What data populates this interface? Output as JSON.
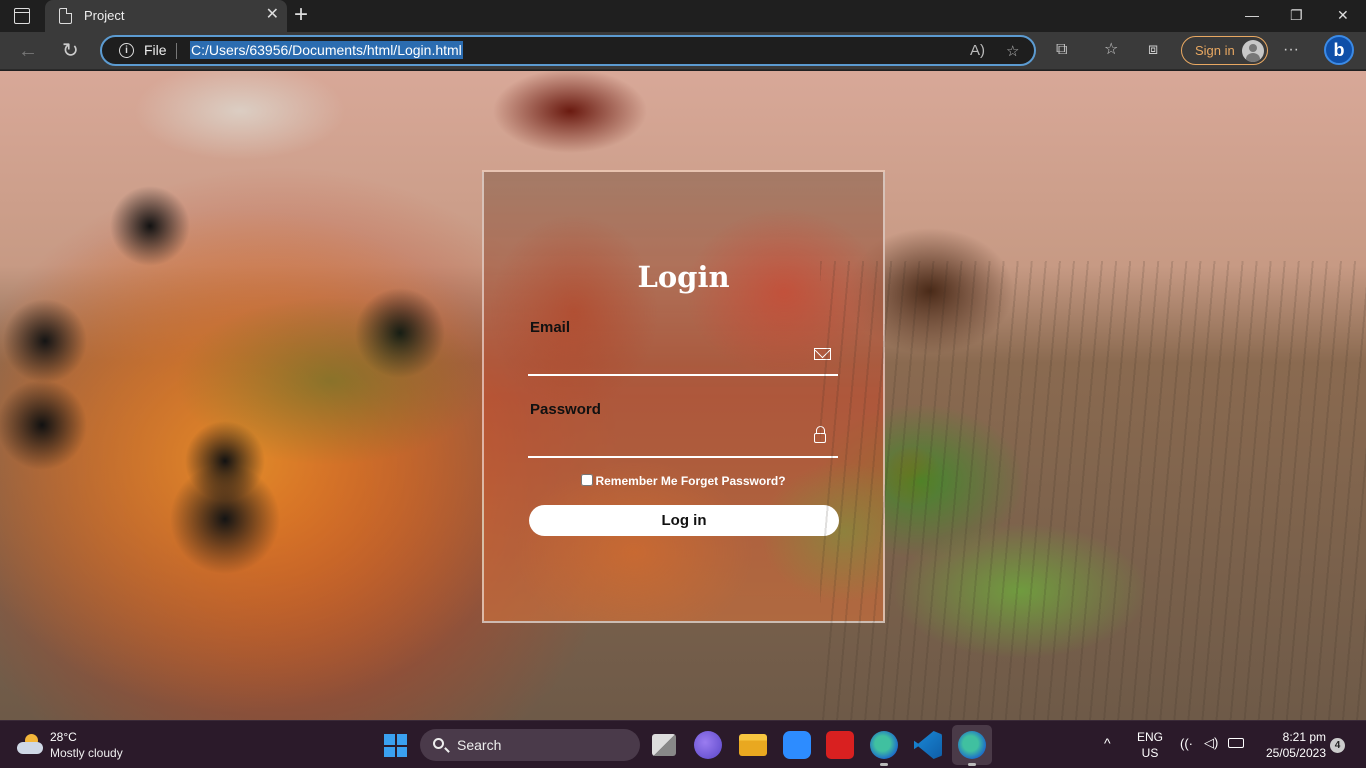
{
  "browser": {
    "tab_title": "Project",
    "tab_close": "✕",
    "new_tab": "+",
    "file_label": "File",
    "url": "C:/Users/63956/Documents/html/Login.html",
    "signin_label": "Sign in",
    "bing_label": "b",
    "window_controls": {
      "minimize": "—",
      "restore": "❐",
      "close": "✕"
    },
    "nav": {
      "back": "←",
      "reload": "↻"
    },
    "toolbar_icons": [
      "read-aloud-icon",
      "add-favorite-icon",
      "extensions-icon",
      "favorites-icon",
      "collections-icon",
      "more-icon"
    ],
    "toolbar_glyphs": {
      "read_aloud": "A)",
      "add_fav": "☆",
      "extensions": "⧉",
      "favorites": "☆",
      "collections": "⧈",
      "more": "···"
    }
  },
  "login": {
    "title": "Login",
    "email_label": "Email",
    "password_label": "Password",
    "remember_label": "Remember Me",
    "forgot_label": "Forget Password?",
    "button_label": "Log in"
  },
  "taskbar": {
    "weather_temp": "28°C",
    "weather_desc": "Mostly cloudy",
    "search_text": "Search",
    "lang_top": "ENG",
    "lang_bottom": "US",
    "time": "8:21 pm",
    "date": "25/05/2023",
    "notification_count": "4",
    "chevron": "^",
    "apps": [
      "task-view-icon",
      "teams-icon",
      "file-explorer-icon",
      "zoom-icon",
      "wps-icon",
      "edge-icon",
      "vscode-icon",
      "edge-dev-icon"
    ]
  },
  "colors": {
    "accent": "#5c9bd1",
    "signin": "#e8a862",
    "taskbar": "#2b1a2a"
  }
}
